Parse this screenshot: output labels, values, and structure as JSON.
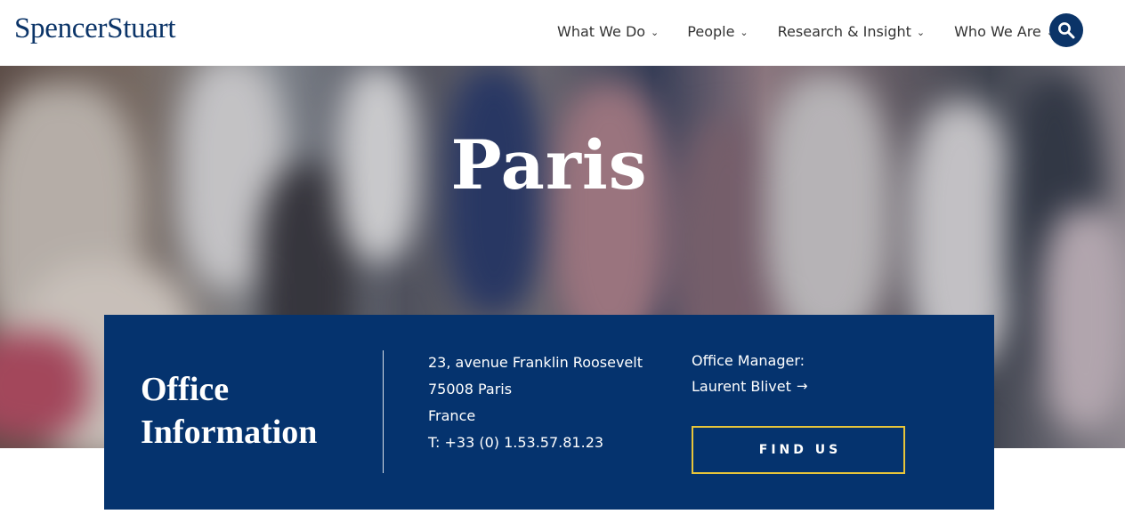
{
  "brand": {
    "logo": "SpencerStuart"
  },
  "nav": {
    "items": [
      {
        "label": "What We Do",
        "icon": "chevron-down-icon"
      },
      {
        "label": "People",
        "icon": "chevron-down-icon"
      },
      {
        "label": "Research & Insight",
        "icon": "chevron-down-icon"
      },
      {
        "label": "Who We Are",
        "icon": "chevron-down-icon"
      }
    ],
    "search_icon": "search-icon"
  },
  "hero": {
    "title": "Paris"
  },
  "office": {
    "heading": "Office Information",
    "address": [
      "23, avenue Franklin Roosevelt",
      "75008 Paris",
      "France",
      "T: +33 (0) 1.53.57.81.23"
    ],
    "manager_label": "Office Manager:",
    "manager_name": "Laurent Blivet",
    "manager_arrow": "→",
    "find_button": "FIND US"
  },
  "colors": {
    "brand_navy": "#05336e",
    "button_border": "#e8c53a",
    "text_white": "#ffffff"
  }
}
